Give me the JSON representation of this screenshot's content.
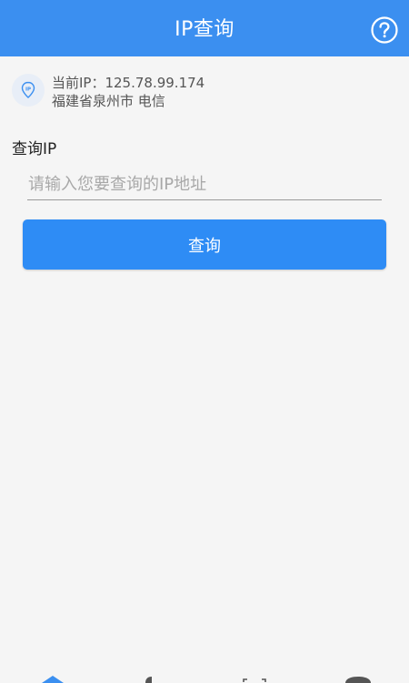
{
  "header": {
    "title": "IP查询",
    "help_icon": "question-circle-icon"
  },
  "current_ip": {
    "icon": "location-pin-icon",
    "ip_label": "当前IP：125.78.99.174",
    "location": "福建省泉州市 电信"
  },
  "query": {
    "label": "查询IP",
    "input_value": "",
    "input_placeholder": "请输入您要查询的IP地址",
    "button_label": "查询"
  },
  "tabbar": {
    "items": [
      {
        "icon": "home-icon",
        "active": true
      },
      {
        "icon": "pie-chart-icon",
        "active": false
      },
      {
        "icon": "scan-icon",
        "active": false
      },
      {
        "icon": "user-icon",
        "active": false
      }
    ]
  },
  "colors": {
    "primary": "#3b8ff0",
    "button": "#2e8cf5",
    "background": "#f5f5f5"
  }
}
